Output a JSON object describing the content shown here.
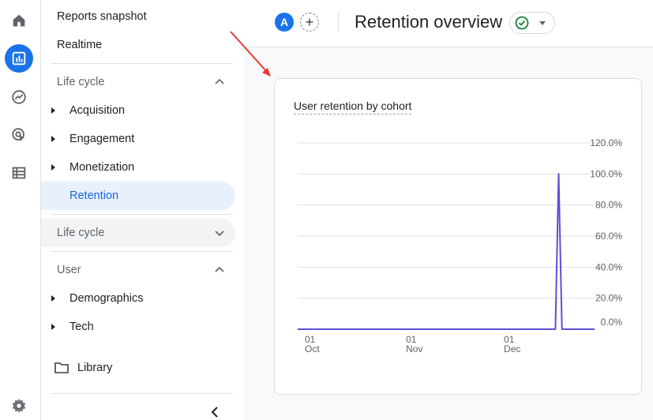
{
  "rail": {
    "items": [
      {
        "name": "home-icon",
        "active": false
      },
      {
        "name": "reports-icon",
        "active": true
      },
      {
        "name": "explore-icon",
        "active": false
      },
      {
        "name": "advertising-icon",
        "active": false
      },
      {
        "name": "configure-icon",
        "active": false
      }
    ],
    "settings_icon": "gear-icon"
  },
  "nav": {
    "top_links": [
      "Reports snapshot",
      "Realtime"
    ],
    "lifecycle_section": {
      "label": "Life cycle",
      "items": [
        "Acquisition",
        "Engagement",
        "Monetization"
      ],
      "selected": "Retention"
    },
    "lifecycle_collapsed": {
      "label": "Life cycle"
    },
    "user_section": {
      "label": "User",
      "items": [
        "Demographics",
        "Tech"
      ]
    },
    "library": "Library"
  },
  "header": {
    "avatar_letter": "A",
    "add_comparison": "+",
    "title": "Retention overview"
  },
  "colors": {
    "accent": "#1a73e8",
    "selected_bg": "#e8f0fe",
    "line": "#5b4fd6",
    "annotation_arrow": "#e53935"
  },
  "card": {
    "title": "User retention by cohort"
  },
  "chart_data": {
    "type": "line",
    "title": "User retention by cohort",
    "xlabel": "",
    "ylabel": "",
    "ylim": [
      0,
      120
    ],
    "y_ticks": [
      "120.0%",
      "100.0%",
      "80.0%",
      "60.0%",
      "40.0%",
      "20.0%",
      "0.0%"
    ],
    "x_ticks": [
      {
        "day": "01",
        "month": "Oct"
      },
      {
        "day": "01",
        "month": "Nov"
      },
      {
        "day": "01",
        "month": "Dec"
      }
    ],
    "series": [
      {
        "color": "#5b4fd6",
        "points": [
          {
            "x": "Oct 01",
            "y": 0
          },
          {
            "x": "Dec 19",
            "y": 0
          },
          {
            "x": "Dec 20",
            "y": 100
          },
          {
            "x": "Dec 21",
            "y": 0
          },
          {
            "x": "Dec 31",
            "y": 0
          }
        ]
      }
    ],
    "grid": true
  }
}
